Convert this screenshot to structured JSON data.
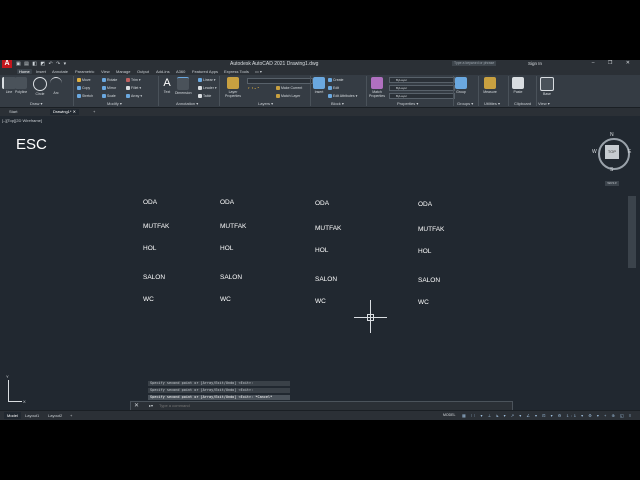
{
  "titlebar": {
    "logo": "A",
    "qat_icons": "▣ ▤ ◧ ◩ ↶ ↷ ▾",
    "title": "Autodesk AutoCAD 2021   Drawing1.dwg",
    "search_placeholder": "Type a keyword or phrase",
    "signin": "Sign In",
    "window_controls": "– ❐ ✕"
  },
  "ribbon_tabs": [
    "Home",
    "Insert",
    "Annotate",
    "Parametric",
    "View",
    "Manage",
    "Output",
    "Add-ins",
    "A360",
    "Featured Apps",
    "Express Tools",
    "▭ ▾"
  ],
  "ribbon": {
    "draw": {
      "line": "Line",
      "polyline": "Polyline",
      "circle": "Circle",
      "arc": "Arc",
      "label": "Draw ▾"
    },
    "modify": {
      "move": "Move",
      "rotate": "Rotate",
      "trim": "Trim ▾",
      "copy": "Copy",
      "mirror": "Mirror",
      "fillet": "Fillet ▾",
      "stretch": "Stretch",
      "scale": "Scale",
      "array": "Array ▾",
      "label": "Modify ▾"
    },
    "annotation": {
      "text": "Text",
      "dimension": "Dimension",
      "linear": "Linear ▾",
      "leader": "Leader ▾",
      "table": "Table",
      "label": "Annotation ▾"
    },
    "layers": {
      "layer_properties": "Layer Properties",
      "make_current": "Make Current",
      "match_layer": "Match Layer",
      "label": "Layers ▾"
    },
    "block": {
      "insert": "Insert",
      "create": "Create",
      "edit": "Edit",
      "edit_attributes": "Edit Attributes ▾",
      "label": "Block ▾"
    },
    "properties": {
      "match_properties": "Match Properties",
      "bylayer1": "ByLayer",
      "bylayer2": "ByLayer",
      "bylayer3": "ByLayer",
      "label": "Properties ▾"
    },
    "groups": {
      "group": "Group",
      "label": "Groups ▾"
    },
    "utilities": {
      "measure": "Measure",
      "label": "Utilities ▾"
    },
    "clipboard": {
      "paste": "Paste",
      "label": "Clipboard"
    },
    "view": {
      "base": "Base",
      "label": "View ▾"
    }
  },
  "file_tabs": {
    "start": "Start",
    "drawing": "Drawing1*",
    "close": "✕",
    "add": "+"
  },
  "canvas": {
    "view_label": "[–][Top][2D Wireframe]",
    "esc_text": "ESC",
    "columns": [
      {
        "oda": "ODA",
        "mutfak": "MUTFAK",
        "hol": "HOL",
        "salon": "SALON",
        "wc": "WC"
      },
      {
        "oda": "ODA",
        "mutfak": "MUTFAK",
        "hol": "HOL",
        "salon": "SALON",
        "wc": "WC"
      },
      {
        "oda": "ODA",
        "mutfak": "MUTFAK",
        "hol": "HOL",
        "salon": "SALON",
        "wc": "WC"
      },
      {
        "oda": "ODA",
        "mutfak": "MUTFAK",
        "hol": "HOL",
        "salon": "SALON",
        "wc": "WC"
      }
    ]
  },
  "viewcube": {
    "top": "TOP",
    "n": "N",
    "s": "S",
    "e": "E",
    "w": "W",
    "wcs": "WCS ▾"
  },
  "ucs": {
    "x": "X",
    "y": "Y"
  },
  "command": {
    "history": [
      "Specify second point or [Array/Exit/Undo] <Exit>:",
      "Specify second point or [Array/Exit/Undo] <Exit>:",
      "Specify second point or [Array/Exit/Undo] <Exit>: *Cancel*"
    ],
    "placeholder": "Type a command",
    "close_icon": "✕",
    "recent_icon": "▸▾"
  },
  "status": {
    "tabs": [
      "Model",
      "Layout1",
      "Layout2",
      "+"
    ],
    "model_label": "MODEL",
    "icons": "▦ ⁝⁝ ▾ ⊥ ⦝ ▾ ↗ ▾ ∠ ▾ ⊡ ▾ ⚙ 1:1 ▾ ⚙ ▾ + ⊕ ◱ ≡"
  }
}
